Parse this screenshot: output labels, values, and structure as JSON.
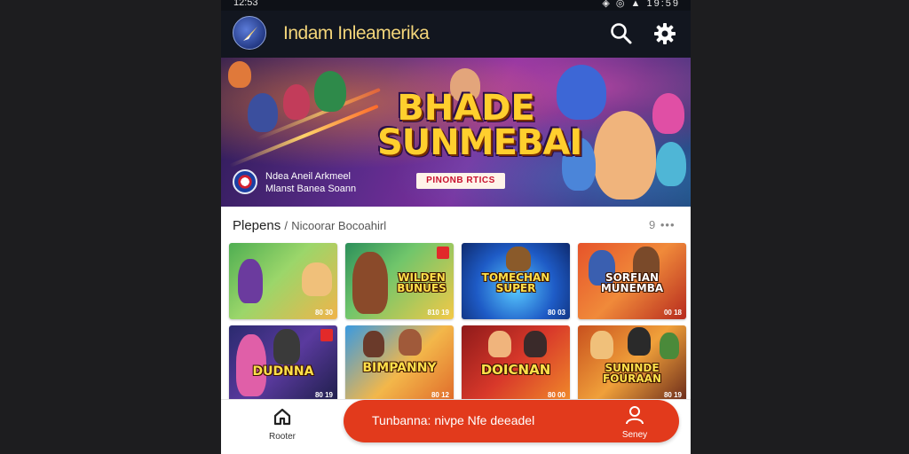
{
  "status_bar": {
    "left": "12:53",
    "right": "◈ ◎ ▲ 19:59"
  },
  "app_bar": {
    "title": "Indam Inleamerika",
    "logo_icon": "compass-logo-icon",
    "search_icon": "search-icon",
    "settings_icon": "gear-icon"
  },
  "banner": {
    "title_line1": "BHADE",
    "title_line2": "SUNMEBAI",
    "tag": "PINONB RTICS",
    "caption_line1": "Ndea Aneil Arkmeel",
    "caption_line2": "Mlanst Banea Soann"
  },
  "section": {
    "title": "Plepens",
    "separator": "/",
    "crumb": "Nicoorar Bocoahirl",
    "more": "9 •••"
  },
  "tiles": [
    {
      "name": "",
      "meta": "80 30"
    },
    {
      "name": "WILDEN BUNUES",
      "meta": "810 19"
    },
    {
      "name": "TOMECHAN SUPER",
      "meta": "80 03"
    },
    {
      "name": "SORFIAN MUNEMBA",
      "meta": "00 18"
    },
    {
      "name": "DUDNNA",
      "meta": "80 19"
    },
    {
      "name": "BIMPANNY",
      "meta": "80 12"
    },
    {
      "name": "DOICNAN",
      "meta": "80 00"
    },
    {
      "name": "SUNINDE FOURAAN",
      "meta": "80 19"
    }
  ],
  "bottom_nav": {
    "home_label": "Rooter",
    "home_icon": "home-icon",
    "cta_label": "Tunbanna: nivpe Nfe deeadel",
    "profile_label": "Seney",
    "profile_icon": "user-icon"
  },
  "colors": {
    "appbar": "#12161f",
    "title": "#f3d57a",
    "cta": "#e23a1c"
  }
}
